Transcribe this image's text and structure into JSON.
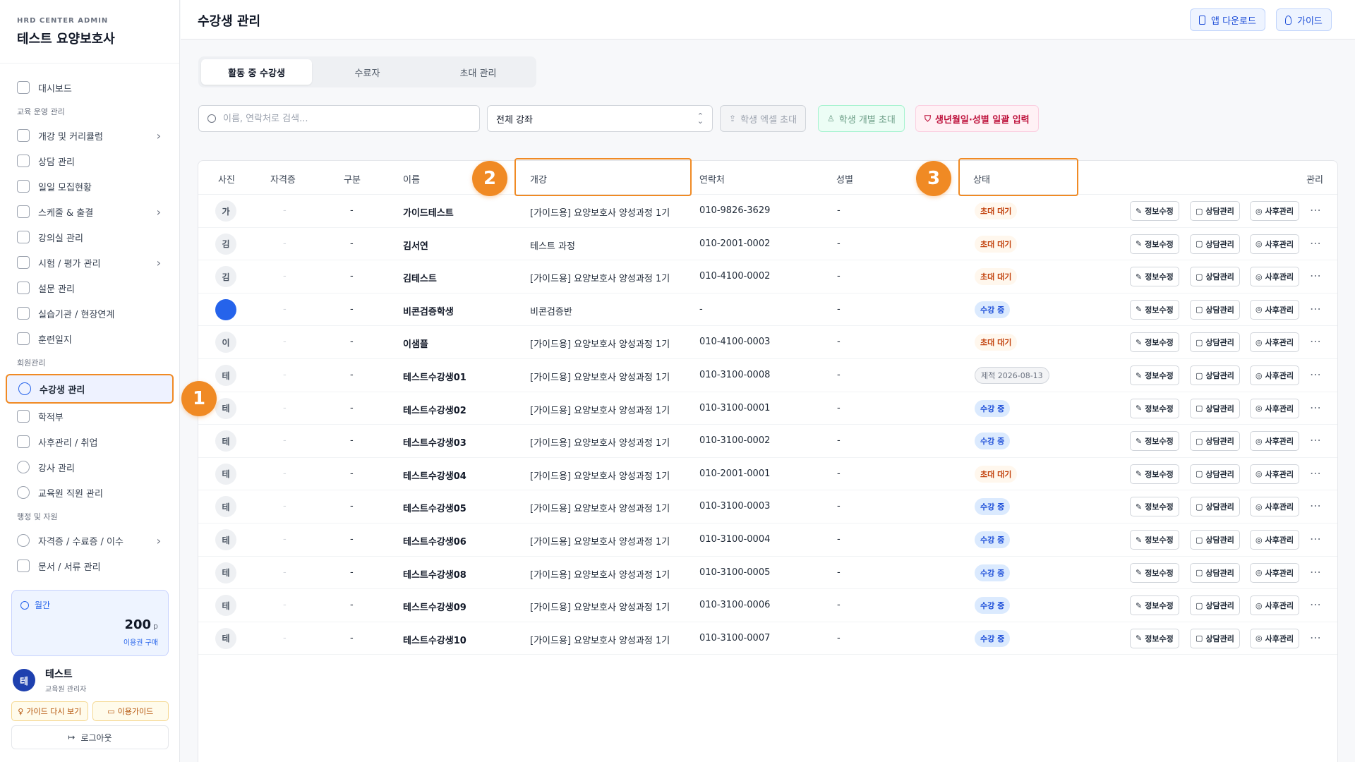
{
  "brand": {
    "sub": "HRD CENTER ADMIN",
    "title": "테스트 요양보호사"
  },
  "sidebar": {
    "items": [
      {
        "type": "item",
        "label": "대시보드",
        "icon": "grid-icon",
        "chevron": false
      },
      {
        "type": "section",
        "label": "교육 운영 관리"
      },
      {
        "type": "item",
        "label": "개강 및 커리큘럼",
        "icon": "book-icon",
        "chevron": true
      },
      {
        "type": "item",
        "label": "상담 관리",
        "icon": "chat-icon",
        "chevron": false
      },
      {
        "type": "item",
        "label": "일일 모집현황",
        "icon": "clipboard-icon",
        "chevron": false
      },
      {
        "type": "item",
        "label": "스케줄 & 출결",
        "icon": "calendar-icon",
        "chevron": true
      },
      {
        "type": "item",
        "label": "강의실 관리",
        "icon": "building-icon",
        "chevron": false
      },
      {
        "type": "item",
        "label": "시험 / 평가 관리",
        "icon": "clipboard-check-icon",
        "chevron": true
      },
      {
        "type": "item",
        "label": "설문 관리",
        "icon": "clipboard-icon",
        "chevron": false
      },
      {
        "type": "item",
        "label": "실습기관 / 현장연계",
        "icon": "building-icon",
        "chevron": false
      },
      {
        "type": "item",
        "label": "훈련일지",
        "icon": "document-icon",
        "chevron": false
      },
      {
        "type": "section",
        "label": "회원관리"
      },
      {
        "type": "item",
        "label": "수강생 관리",
        "icon": "users-icon",
        "chevron": false,
        "active": true
      },
      {
        "type": "item",
        "label": "학적부",
        "icon": "graduation-cap-icon",
        "chevron": false
      },
      {
        "type": "item",
        "label": "사후관리 / 취업",
        "icon": "briefcase-icon",
        "chevron": false
      },
      {
        "type": "item",
        "label": "강사 관리",
        "icon": "user-circle-icon",
        "chevron": false
      },
      {
        "type": "item",
        "label": "교육원 직원 관리",
        "icon": "user-cog-icon",
        "chevron": false
      },
      {
        "type": "section",
        "label": "행정 및 자원"
      },
      {
        "type": "item",
        "label": "자격증 / 수료증 / 이수",
        "icon": "award-icon",
        "chevron": true
      },
      {
        "type": "item",
        "label": "문서 / 서류 관리",
        "icon": "folder-icon",
        "chevron": false
      }
    ]
  },
  "plan": {
    "label": "월간",
    "points": "200",
    "unit": "p",
    "link": "이용권 구매"
  },
  "user": {
    "initial": "테",
    "name": "테스트",
    "role": "교육원 관리자"
  },
  "footer": {
    "guide_again": "가이드 다시 보기",
    "usage_guide": "이용가이드",
    "logout": "로그아웃"
  },
  "header": {
    "title": "수강생 관리",
    "app_download": "앱 다운로드",
    "guide": "가이드"
  },
  "tabs": [
    "활동 중 수강생",
    "수료자",
    "초대 관리"
  ],
  "filters": {
    "search_placeholder": "이름, 연락처로 검색...",
    "course_select": "전체 강좌",
    "excel_invite": "학생 엑셀 초대",
    "single_invite": "학생 개별 초대",
    "bulk_input": "생년월일·성별 일괄 입력"
  },
  "table": {
    "headers": {
      "photo": "사진",
      "cert": "자격증",
      "category": "구분",
      "name": "이름",
      "course": "개강",
      "phone": "연락처",
      "gender": "성별",
      "status": "상태",
      "manage": "관리"
    },
    "action_labels": {
      "edit": "정보수정",
      "consult": "상담관리",
      "followup": "사후관리"
    },
    "rows": [
      {
        "initial": "가",
        "cert": "-",
        "category": "-",
        "name": "가이드테스트",
        "course": "[가이드용] 요양보호사 양성과정 1기",
        "phone": "010-9826-3629",
        "gender": "-",
        "status": "초대 대기",
        "status_type": "wait"
      },
      {
        "initial": "김",
        "cert": "-",
        "category": "-",
        "name": "김서연",
        "course": "테스트 과정",
        "phone": "010-2001-0002",
        "gender": "-",
        "status": "초대 대기",
        "status_type": "wait"
      },
      {
        "initial": "김",
        "cert": "-",
        "category": "-",
        "name": "김테스트",
        "course": "[가이드용] 요양보호사 양성과정 1기",
        "phone": "010-4100-0002",
        "gender": "-",
        "status": "초대 대기",
        "status_type": "wait"
      },
      {
        "initial": "",
        "cert": "-",
        "category": "-",
        "name": "비콘검증학생",
        "course": "비콘검증반",
        "phone": "-",
        "gender": "-",
        "status": "수강 중",
        "status_type": "active",
        "photo": true
      },
      {
        "initial": "이",
        "cert": "-",
        "category": "-",
        "name": "이샘플",
        "course": "[가이드용] 요양보호사 양성과정 1기",
        "phone": "010-4100-0003",
        "gender": "-",
        "status": "초대 대기",
        "status_type": "wait"
      },
      {
        "initial": "테",
        "cert": "-",
        "category": "-",
        "name": "테스트수강생01",
        "course": "[가이드용] 요양보호사 양성과정 1기",
        "phone": "010-3100-0008",
        "gender": "-",
        "status": "제적 2026-08-13",
        "status_type": "expelled"
      },
      {
        "initial": "테",
        "cert": "-",
        "category": "-",
        "name": "테스트수강생02",
        "course": "[가이드용] 요양보호사 양성과정 1기",
        "phone": "010-3100-0001",
        "gender": "-",
        "status": "수강 중",
        "status_type": "active"
      },
      {
        "initial": "테",
        "cert": "-",
        "category": "-",
        "name": "테스트수강생03",
        "course": "[가이드용] 요양보호사 양성과정 1기",
        "phone": "010-3100-0002",
        "gender": "-",
        "status": "수강 중",
        "status_type": "active"
      },
      {
        "initial": "테",
        "cert": "-",
        "category": "-",
        "name": "테스트수강생04",
        "course": "[가이드용] 요양보호사 양성과정 1기",
        "phone": "010-2001-0001",
        "gender": "-",
        "status": "초대 대기",
        "status_type": "wait"
      },
      {
        "initial": "테",
        "cert": "-",
        "category": "-",
        "name": "테스트수강생05",
        "course": "[가이드용] 요양보호사 양성과정 1기",
        "phone": "010-3100-0003",
        "gender": "-",
        "status": "수강 중",
        "status_type": "active"
      },
      {
        "initial": "테",
        "cert": "-",
        "category": "-",
        "name": "테스트수강생06",
        "course": "[가이드용] 요양보호사 양성과정 1기",
        "phone": "010-3100-0004",
        "gender": "-",
        "status": "수강 중",
        "status_type": "active"
      },
      {
        "initial": "테",
        "cert": "-",
        "category": "-",
        "name": "테스트수강생08",
        "course": "[가이드용] 요양보호사 양성과정 1기",
        "phone": "010-3100-0005",
        "gender": "-",
        "status": "수강 중",
        "status_type": "active"
      },
      {
        "initial": "테",
        "cert": "-",
        "category": "-",
        "name": "테스트수강생09",
        "course": "[가이드용] 요양보호사 양성과정 1기",
        "phone": "010-3100-0006",
        "gender": "-",
        "status": "수강 중",
        "status_type": "active"
      },
      {
        "initial": "테",
        "cert": "-",
        "category": "-",
        "name": "테스트수강생10",
        "course": "[가이드용] 요양보호사 양성과정 1기",
        "phone": "010-3100-0007",
        "gender": "-",
        "status": "수강 중",
        "status_type": "active"
      }
    ]
  },
  "callouts": [
    "1",
    "2",
    "3"
  ],
  "colors": {
    "accent": "#2563eb",
    "highlight": "#f08a24",
    "wait": "#c2410c",
    "active_badge": "#1d4ed8"
  }
}
